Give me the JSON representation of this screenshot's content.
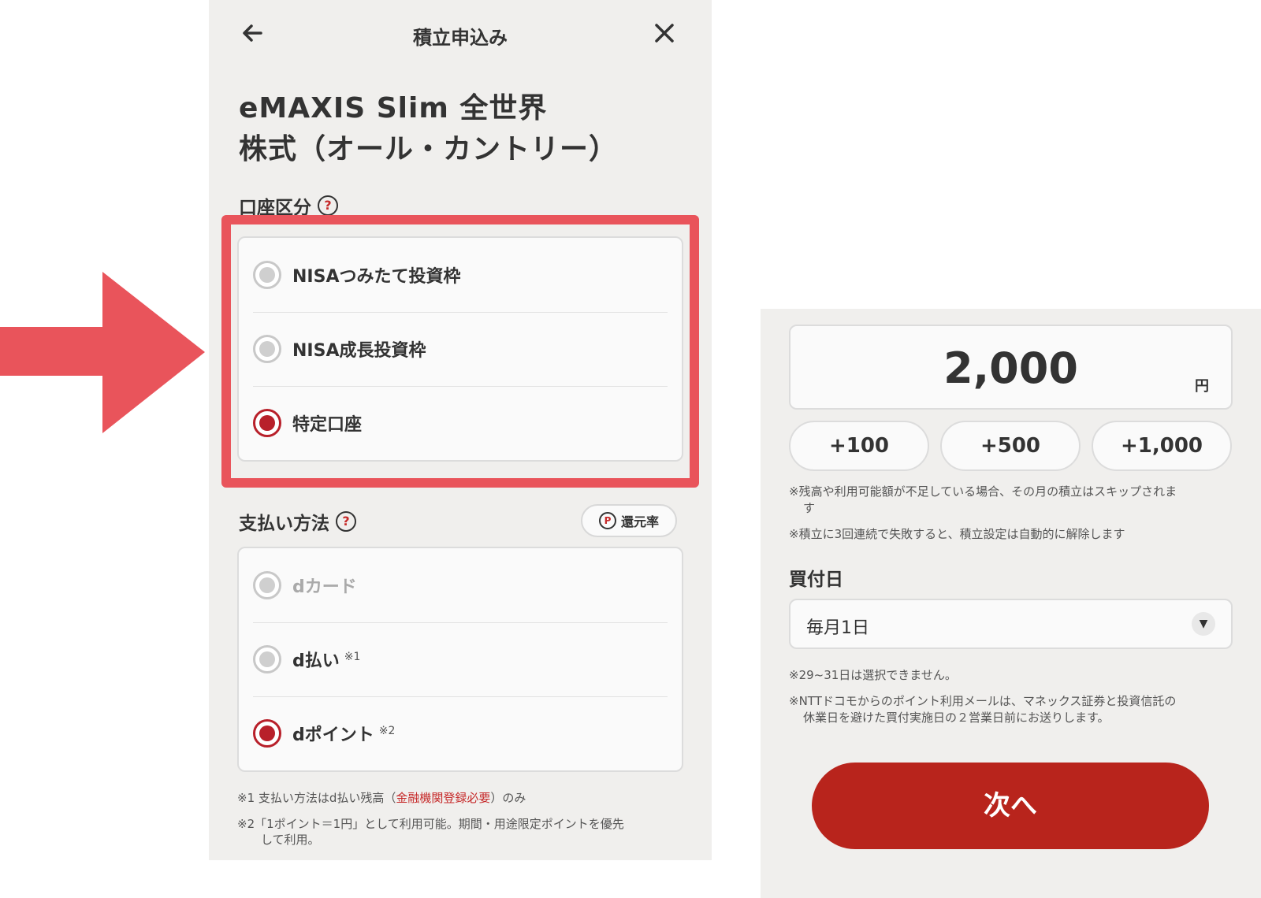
{
  "colors": {
    "accent": "#b8202a",
    "highlight": "#e9545b",
    "panel_bg": "#f0efed",
    "next_button": "#b8241c"
  },
  "left": {
    "header": {
      "back_icon": "arrow-left-icon",
      "title": "積立申込み",
      "close_icon": "close-icon"
    },
    "fund_name_line1": "eMAXIS Slim 全世界",
    "fund_name_line2": "株式（オール・カントリー）",
    "account_section": {
      "label": "口座区分",
      "help": "?",
      "options": [
        {
          "label": "NISAつみたて投資枠",
          "selected": false
        },
        {
          "label": "NISA成長投資枠",
          "selected": false
        },
        {
          "label": "特定口座",
          "selected": true
        }
      ]
    },
    "payment_section": {
      "label": "支払い方法",
      "help": "?",
      "rate_button": {
        "icon": "P",
        "label": "還元率"
      },
      "options": [
        {
          "label": "dカード",
          "sup": "",
          "selected": false,
          "disabled": true
        },
        {
          "label": "d払い",
          "sup": "※1",
          "selected": false,
          "disabled": false
        },
        {
          "label": "dポイント",
          "sup": "※2",
          "selected": true,
          "disabled": false
        }
      ]
    },
    "note1": {
      "prefix": "※1 支払い方法はd払い残高（",
      "link": "金融機関登録必要",
      "suffix": "）のみ"
    },
    "note2_line1": "※2「1ポイント＝1円」として利用可能。期間・用途限定ポイントを優先",
    "note2_line2": "して利用。"
  },
  "right": {
    "amount": "2,000",
    "unit": "円",
    "increments": [
      "+100",
      "+500",
      "+1,000"
    ],
    "note_skip_line1": "※残高や利用可能額が不足している場合、その月の積立はスキップされま",
    "note_skip_line2": "す",
    "note_cancel": "※積立に3回連続で失敗すると、積立設定は自動的に解除します",
    "buy_day_label": "買付日",
    "buy_day_value": "毎月1日",
    "note_days": "※29~31日は選択できません。",
    "note_ntt_line1": "※NTTドコモからのポイント利用メールは、マネックス証券と投資信託の",
    "note_ntt_line2": "休業日を避けた買付実施日の２営業日前にお送りします。",
    "next_label": "次へ"
  }
}
